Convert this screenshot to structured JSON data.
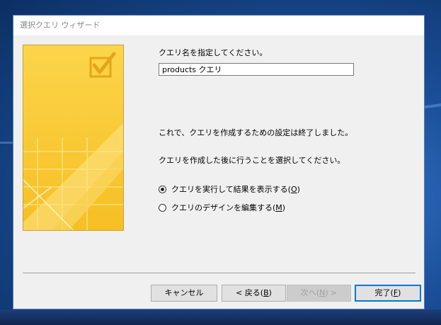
{
  "window": {
    "title": "選択クエリ ウィザード"
  },
  "form": {
    "name_prompt": "クエリ名を指定してください。",
    "name_value": "products クエリ",
    "finish_message": "これで、クエリを作成するための設定は終了しました。",
    "next_step_prompt": "クエリを作成した後に行うことを選択してください。"
  },
  "options": [
    {
      "label": "クエリを実行して結果を表示する(",
      "key": "O",
      "suffix": ")",
      "selected": true
    },
    {
      "label": "クエリのデザインを編集する(",
      "key": "M",
      "suffix": ")",
      "selected": false
    }
  ],
  "buttons": {
    "cancel": "キャンセル",
    "back_prefix": "< 戻る(",
    "back_key": "B",
    "back_suffix": ")",
    "next_prefix": "次へ(",
    "next_key": "N",
    "next_suffix": ") >",
    "finish_prefix": "完了(",
    "finish_key": "F",
    "finish_suffix": ")"
  },
  "colors": {
    "art_yellow": "#f7c630",
    "art_light": "#fde68a",
    "accent_blue": "#0078d7"
  },
  "icons": {
    "wizard_art": "checkbox-check-icon"
  }
}
